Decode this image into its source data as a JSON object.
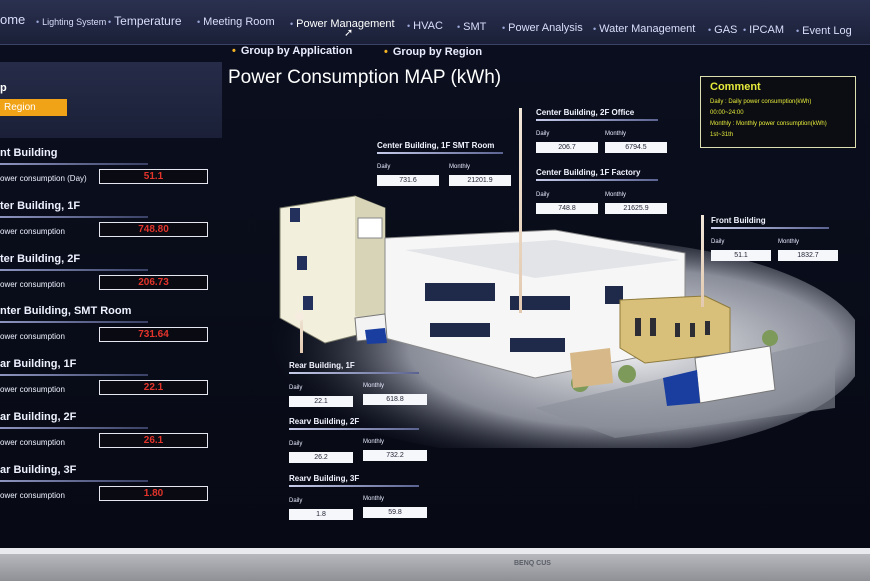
{
  "nav": {
    "items": [
      {
        "label": "ome"
      },
      {
        "label": "Lighting System"
      },
      {
        "label": "Temperature"
      },
      {
        "label": "Meeting Room"
      },
      {
        "label": "Power Management"
      },
      {
        "label": "HVAC"
      },
      {
        "label": "SMT"
      },
      {
        "label": "Power Analysis"
      },
      {
        "label": "Water Management"
      },
      {
        "label": "GAS"
      },
      {
        "label": "IPCAM"
      },
      {
        "label": "Event Log"
      }
    ]
  },
  "subtabs": {
    "application": "Group by Application",
    "region": "Group by Region"
  },
  "sidebar": {
    "title": "p",
    "region_button": "Region",
    "sections": [
      {
        "name": "nt Building",
        "label": "ower consumption (Day)",
        "value": "51.1"
      },
      {
        "name": "ter Building, 1F",
        "label": "ower consumption",
        "value": "748.80"
      },
      {
        "name": "ter Building, 2F",
        "label": "ower consumption",
        "value": "206.73"
      },
      {
        "name": "nter Building, SMT Room",
        "label": "ower consumption",
        "value": "731.64"
      },
      {
        "name": "ar Building, 1F",
        "label": "ower consumption",
        "value": "22.1"
      },
      {
        "name": "ar Building, 2F",
        "label": "ower consumption",
        "value": "26.1"
      },
      {
        "name": "ar Building, 3F",
        "label": "ower consumption",
        "value": "1.80"
      }
    ]
  },
  "main": {
    "title": "Power Consumption MAP (kWh)"
  },
  "comment": {
    "title": "Comment",
    "lines": [
      "Daily : Daily power consumption(kWh)",
      "00:00~24:00",
      "Monthly : Monthly power consumption(kWh)",
      "1st~31th"
    ]
  },
  "panels": {
    "labels": {
      "daily": "Daily",
      "monthly": "Monthly"
    },
    "center_2f_office": {
      "title": "Center Building, 2F Office",
      "daily": "206.7",
      "monthly": "6794.5"
    },
    "center_1f_smt": {
      "title": "Center Building, 1F SMT Room",
      "daily": "731.6",
      "monthly": "21201.9"
    },
    "center_1f_factory": {
      "title": "Center Building, 1F Factory",
      "daily": "748.8",
      "monthly": "21625.9"
    },
    "front": {
      "title": "Front Building",
      "daily": "51.1",
      "monthly": "1832.7"
    },
    "rear_1f": {
      "title": "Rear Building, 1F",
      "daily": "22.1",
      "monthly": "618.8"
    },
    "rear_2f": {
      "title": "Rearv Building, 2F",
      "daily": "26.2",
      "monthly": "732.2"
    },
    "rear_3f": {
      "title": "Rearv Building, 3F",
      "daily": "1.8",
      "monthly": "59.8"
    }
  },
  "monitor": {
    "brand": "BENQ CUS"
  },
  "colors": {
    "accent_orange": "#f0a316",
    "value_red": "#e3342b",
    "comment_yellow": "#e6ea3a"
  }
}
